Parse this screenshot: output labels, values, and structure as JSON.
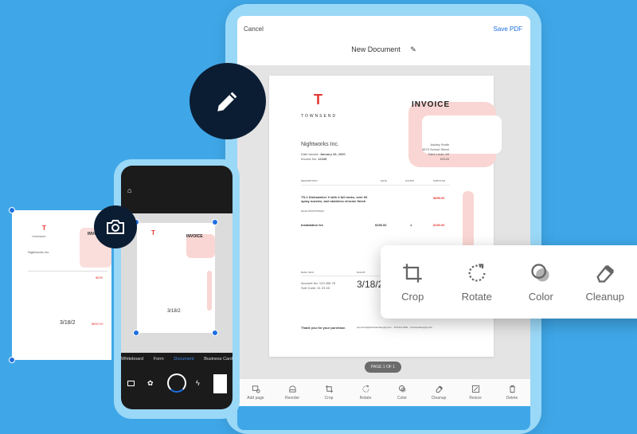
{
  "tablet": {
    "cancel": "Cancel",
    "save": "Save PDF",
    "title": "New Document",
    "page_indicator": "PAGE 1 OF 1",
    "toolbar": [
      {
        "label": "Add page",
        "icon": "add-page-icon"
      },
      {
        "label": "Reorder",
        "icon": "reorder-icon"
      },
      {
        "label": "Crop",
        "icon": "crop-icon"
      },
      {
        "label": "Rotate",
        "icon": "rotate-icon"
      },
      {
        "label": "Color",
        "icon": "color-icon"
      },
      {
        "label": "Cleanup",
        "icon": "cleanup-icon"
      },
      {
        "label": "Resize",
        "icon": "resize-icon"
      },
      {
        "label": "Delete",
        "icon": "delete-icon"
      }
    ]
  },
  "invoice": {
    "brand": "TOWNSEND",
    "heading": "INVOICE",
    "client": "Nightworks Inc.",
    "date_label": "Date Issued:",
    "date": "January 28, 2020",
    "inv_label": "Invoice No:",
    "inv_no": "12345",
    "address": [
      "Ashley Smith",
      "3679 School Street",
      "Saint Louis, MI",
      "63145"
    ],
    "cols": [
      "DESCRIPTION",
      "RATE",
      "HOURS",
      "SUBTOTAL"
    ],
    "item1": "TS-1 Dishwasher X with 4 full racks, over 60 spray nozzles, and stainless chrome finish",
    "item1_model": "Model DWSX700S2N",
    "item1_sub": "$899.00",
    "item2": "Installation fee",
    "item2_rate": "$150.00",
    "item2_hours": "1",
    "item2_sub": "$150.00",
    "bank_label": "BANK INFO",
    "due_label": "DUE BY",
    "account": "Account No: 123 456 78",
    "sort": "Sort Code: 01 23 45",
    "due": "3/18/2",
    "thanks": "Thank you for your purchase.",
    "footer": "payments@townsendsupply.com · 415.211.2001 · townsendsupply.com"
  },
  "phone": {
    "modes": [
      "Whiteboard",
      "Form",
      "Document",
      "Business Card"
    ],
    "active_mode": "Document"
  },
  "popup": [
    {
      "label": "Crop",
      "icon": "crop-icon"
    },
    {
      "label": "Rotate",
      "icon": "rotate-icon"
    },
    {
      "label": "Color",
      "icon": "color-icon"
    },
    {
      "label": "Cleanup",
      "icon": "cleanup-icon"
    }
  ],
  "colors": {
    "background": "#3fa7e8",
    "accent": "#1e6fe0",
    "badge": "#0b1d33",
    "red": "#e53935"
  }
}
